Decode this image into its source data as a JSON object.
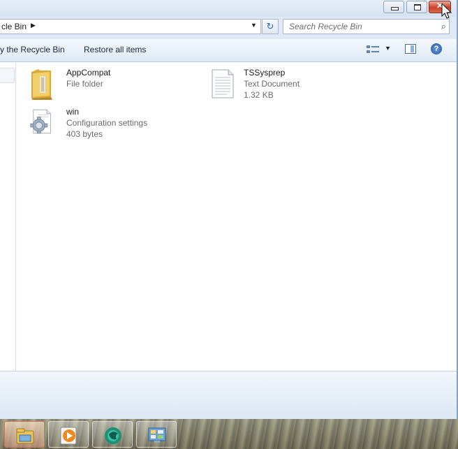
{
  "window": {
    "close_glyph": "✕"
  },
  "addressbar": {
    "path_text": "cle Bin",
    "crumb_arrow": "▶",
    "dropdown_arrow": "▼",
    "refresh_glyph": "↻"
  },
  "search": {
    "placeholder": "Search Recycle Bin",
    "icon": "⌕"
  },
  "toolbar": {
    "empty_label": "y the Recycle Bin",
    "restore_label": "Restore all items",
    "views_dropdown": "▼",
    "help_label": "?"
  },
  "files": [
    {
      "name": "AppCompat",
      "type": "File folder",
      "size": "",
      "icon": "folder-icon"
    },
    {
      "name": "TSSysprep",
      "type": "Text Document",
      "size": "1.32 KB",
      "icon": "text-document-icon"
    },
    {
      "name": "win",
      "type": "Configuration settings",
      "size": "403 bytes",
      "icon": "config-settings-icon"
    }
  ],
  "taskbar": {
    "buttons": [
      {
        "icon": "windows-explorer-icon",
        "active": true
      },
      {
        "icon": "media-player-icon",
        "active": false
      },
      {
        "icon": "globe-app-icon",
        "active": false
      },
      {
        "icon": "control-panel-icon",
        "active": false
      }
    ]
  },
  "colors": {
    "accent": "#2f66b3",
    "close_button": "#c8432a",
    "window_frame": "#dfe9f5"
  }
}
